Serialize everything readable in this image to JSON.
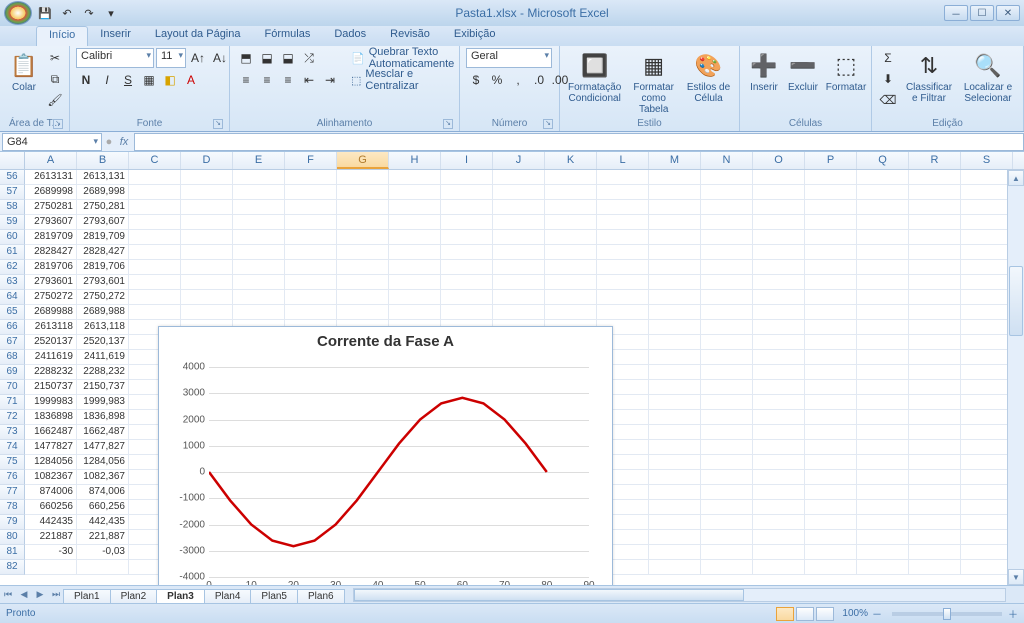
{
  "title": "Pasta1.xlsx - Microsoft Excel",
  "qat": {
    "save_icon": "💾",
    "undo_icon": "↶",
    "redo_icon": "↷"
  },
  "tabs": [
    "Início",
    "Inserir",
    "Layout da Página",
    "Fórmulas",
    "Dados",
    "Revisão",
    "Exibição"
  ],
  "active_tab": 0,
  "ribbon": {
    "clipboard": {
      "label": "Área de T...",
      "paste": "Colar"
    },
    "font": {
      "label": "Fonte",
      "family": "Calibri",
      "size": "11",
      "bold": "N",
      "italic": "I",
      "underline": "S"
    },
    "alignment": {
      "label": "Alinhamento",
      "wrap": "Quebrar Texto Automaticamente",
      "merge": "Mesclar e Centralizar"
    },
    "number": {
      "label": "Número",
      "format": "Geral"
    },
    "styles": {
      "label": "Estilo",
      "cond": "Formatação Condicional",
      "table": "Formatar como Tabela",
      "cell": "Estilos de Célula"
    },
    "cells": {
      "label": "Células",
      "insert": "Inserir",
      "delete": "Excluir",
      "format": "Formatar"
    },
    "editing": {
      "label": "Edição",
      "sort": "Classificar e Filtrar",
      "find": "Localizar e Selecionar"
    }
  },
  "namebox": "G84",
  "formula": "",
  "columns": [
    "A",
    "B",
    "C",
    "D",
    "E",
    "F",
    "G",
    "H",
    "I",
    "J",
    "K",
    "L",
    "M",
    "N",
    "O",
    "P",
    "Q",
    "R",
    "S"
  ],
  "selected_col": 6,
  "first_row": 56,
  "rows": [
    {
      "A": "2613131",
      "B": "2613,131"
    },
    {
      "A": "2689998",
      "B": "2689,998"
    },
    {
      "A": "2750281",
      "B": "2750,281"
    },
    {
      "A": "2793607",
      "B": "2793,607"
    },
    {
      "A": "2819709",
      "B": "2819,709"
    },
    {
      "A": "2828427",
      "B": "2828,427"
    },
    {
      "A": "2819706",
      "B": "2819,706"
    },
    {
      "A": "2793601",
      "B": "2793,601"
    },
    {
      "A": "2750272",
      "B": "2750,272"
    },
    {
      "A": "2689988",
      "B": "2689,988"
    },
    {
      "A": "2613118",
      "B": "2613,118"
    },
    {
      "A": "2520137",
      "B": "2520,137"
    },
    {
      "A": "2411619",
      "B": "2411,619"
    },
    {
      "A": "2288232",
      "B": "2288,232"
    },
    {
      "A": "2150737",
      "B": "2150,737"
    },
    {
      "A": "1999983",
      "B": "1999,983"
    },
    {
      "A": "1836898",
      "B": "1836,898"
    },
    {
      "A": "1662487",
      "B": "1662,487"
    },
    {
      "A": "1477827",
      "B": "1477,827"
    },
    {
      "A": "1284056",
      "B": "1284,056"
    },
    {
      "A": "1082367",
      "B": "1082,367"
    },
    {
      "A": "874006",
      "B": "874,006"
    },
    {
      "A": "660256",
      "B": "660,256"
    },
    {
      "A": "442435",
      "B": "442,435"
    },
    {
      "A": "221887",
      "B": "221,887"
    },
    {
      "A": "-30",
      "B": "-0,03"
    },
    {
      "A": "",
      "B": ""
    }
  ],
  "chart_data": {
    "type": "line",
    "title": "Corrente da Fase A",
    "xlabel": "",
    "ylabel": "",
    "xlim": [
      0,
      90
    ],
    "ylim": [
      -4000,
      4000
    ],
    "xticks": [
      0,
      10,
      20,
      30,
      40,
      50,
      60,
      70,
      80,
      90
    ],
    "yticks": [
      -4000,
      -3000,
      -2000,
      -1000,
      0,
      1000,
      2000,
      3000,
      4000
    ],
    "x": [
      0,
      5,
      10,
      15,
      20,
      25,
      30,
      35,
      40,
      45,
      50,
      55,
      60,
      65,
      70,
      75,
      80
    ],
    "values": [
      0,
      -1082,
      -1999,
      -2613,
      -2828,
      -2613,
      -1999,
      -1082,
      0,
      1082,
      1999,
      2613,
      2828,
      2613,
      1999,
      1082,
      0
    ],
    "color": "#cc0000"
  },
  "sheets": [
    "Plan1",
    "Plan2",
    "Plan3",
    "Plan4",
    "Plan5",
    "Plan6"
  ],
  "active_sheet": 2,
  "status": {
    "ready": "Pronto",
    "zoom": "100%"
  }
}
